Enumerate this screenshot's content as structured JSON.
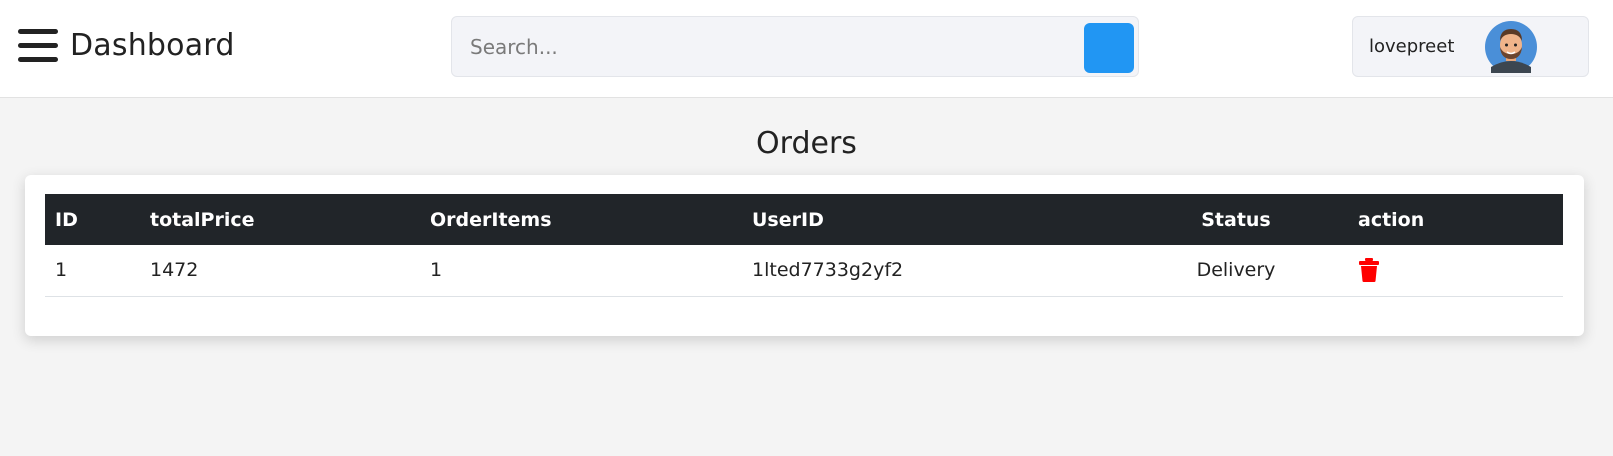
{
  "header": {
    "title": "Dashboard",
    "search": {
      "placeholder": "Search...",
      "value": ""
    },
    "user": {
      "name": "lovepreet"
    }
  },
  "main": {
    "title": "Orders",
    "table": {
      "columns": [
        "ID",
        "totalPrice",
        "OrderItems",
        "UserID",
        "Status",
        "action"
      ],
      "rows": [
        {
          "id": "1",
          "totalPrice": "1472",
          "orderItems": "1",
          "userId": "1lted7733g2yf2",
          "status": "Delivery",
          "action": "trash-icon"
        }
      ]
    }
  },
  "colors": {
    "accent": "#2196f3",
    "table_header_bg": "#212529",
    "delete": "#ff0000"
  }
}
